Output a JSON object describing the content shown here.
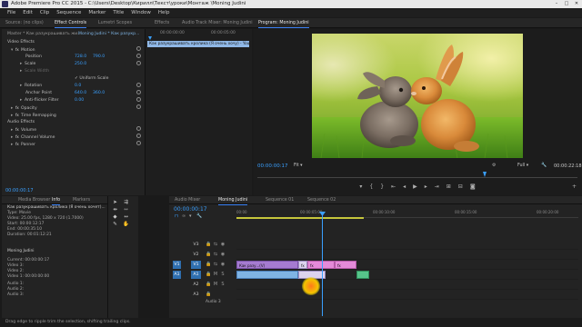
{
  "window": {
    "title": "Adobe Premiere Pro CC 2015 - C:\\Users\\Desktop\\Кирилл\\Текст\\уроки\\Монтаж \\Moning Judini",
    "minimize_icon": "minimize-icon",
    "maximize_icon": "maximize-icon",
    "close_icon": "close-icon"
  },
  "menu": [
    "File",
    "Edit",
    "Clip",
    "Sequence",
    "Marker",
    "Title",
    "Window",
    "Help"
  ],
  "top_tabs": {
    "source": "Source: (no clips)",
    "effect_controls": "Effect Controls",
    "lumetri": "Lumetri Scopes",
    "effects": "Effects",
    "audio_mixer": "Audio Track Mixer: Moning Judini",
    "program": "Program: Moning Judini"
  },
  "effect_controls": {
    "master": "Master * Как разукрашивать жи...",
    "sequence": "Moning Judini * Как разукр...",
    "clip_bar": "Как разукрашивать кролика (Я очень хочу) - YouTube.mp4",
    "rows": [
      {
        "label": "Video Effects",
        "indent": 0
      },
      {
        "label": "Motion",
        "indent": 1
      },
      {
        "label": "Position",
        "indent": 2,
        "v1": "728.0",
        "v2": "790.0"
      },
      {
        "label": "Scale",
        "indent": 2,
        "v1": "250.0"
      },
      {
        "label": "Scale Width",
        "indent": 2,
        "v1": ""
      },
      {
        "label": "Uniform Scale",
        "indent": 3,
        "v1": ""
      },
      {
        "label": "Rotation",
        "indent": 2,
        "v1": "0.0"
      },
      {
        "label": "Anchor Point",
        "indent": 2,
        "v1": "640.0",
        "v2": "360.0"
      },
      {
        "label": "Anti-flicker Filter",
        "indent": 2,
        "v1": "0.00"
      },
      {
        "label": "Opacity",
        "indent": 1
      },
      {
        "label": "Time Remapping",
        "indent": 1
      },
      {
        "label": "Audio Effects",
        "indent": 0
      },
      {
        "label": "Volume",
        "indent": 1
      },
      {
        "label": "Channel Volume",
        "indent": 1
      },
      {
        "label": "Panner",
        "indent": 1
      }
    ],
    "ruler_start": "00:00:00:00",
    "ruler_end": "00:00:05:00",
    "time": "00:00:00:17"
  },
  "program": {
    "time": "00:00:00:17",
    "fit": "Fit",
    "quality": "Full",
    "duration": "00:00:22:18",
    "controls": [
      "marker-icon",
      "in-point-icon",
      "out-point-icon",
      "go-to-in-icon",
      "step-back-icon",
      "play-icon",
      "step-forward-icon",
      "go-to-out-icon",
      "insert-icon",
      "overwrite-icon",
      "export-frame-icon"
    ]
  },
  "info": {
    "tabs": [
      "Media Browser",
      "Info",
      "Markers"
    ],
    "clip_name": "Как разукрашивать кролика (Я очень хочет)...",
    "lines": [
      "Type: Movie",
      "Video: 25.00 fps, 1280 x 720 (1.7000)",
      "Start: 00:00:12:17",
      "End: 00:00:35:10",
      "Duration: 00:01:12:21"
    ],
    "seq_title": "Moning Judini",
    "seq_lines": [
      "Current: 00:00:00:17",
      "Video 3:",
      "Video 2:",
      "Video 1: 00:00:00:00",
      "Audio 1:",
      "Audio 2:",
      "Audio 3:"
    ]
  },
  "timeline": {
    "tabs": [
      "Audio Mixer",
      "Moning Judini",
      "Sequence 01",
      "Sequence 02"
    ],
    "time": "00:00:00:17",
    "ticks": [
      "00:00",
      "00:00:05:00",
      "00:00:10:00",
      "00:00:15:00",
      "00:00:20:00"
    ],
    "video_tracks": [
      "V3",
      "V2",
      "V1"
    ],
    "audio_tracks": [
      "A1",
      "A2",
      "A3"
    ],
    "target_v": "V1",
    "target_a": "A1",
    "clips": {
      "v1a": "Как разу...(V)",
      "v1b": "fx",
      "v1c": "fx",
      "v1d": "fx",
      "a1a": "",
      "a1b": "",
      "a1c": ""
    },
    "audio_label": "Audio 3"
  },
  "status": "Drag edge to ripple trim the selection, shifting trailing clips."
}
